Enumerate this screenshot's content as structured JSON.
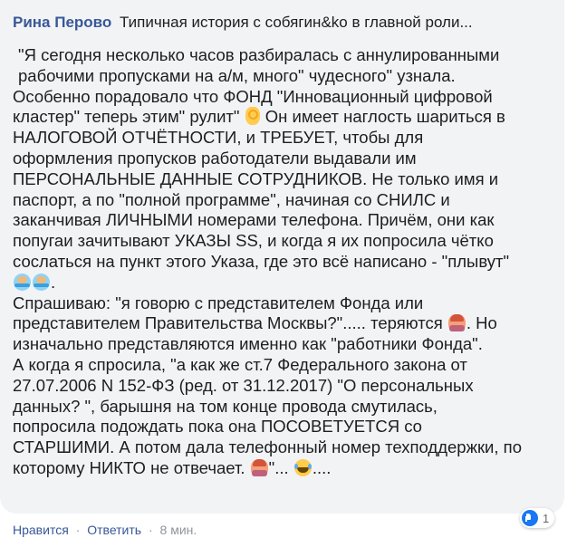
{
  "comment": {
    "author": "Рина Перово",
    "header_text": "Типичная история с собягин&ko в главной роли...",
    "body_lines": [
      {
        "text": "\"Я сегодня несколько часов разбиралась с аннулированными",
        "indent": true
      },
      {
        "text": "рабочими пропусками на а/м, много\" чудесного\" узнала.",
        "indent": true
      },
      {
        "text": "Особенно порадовало что ФОНД \"Инновационный цифровой",
        "indent": false
      },
      {
        "text": "кластер\" теперь этим\" рулит\"",
        "indent": false
      },
      {
        "text": " Он имеет наглость шариться в",
        "indent": false
      },
      {
        "text": "НАЛОГОВОЙ ОТЧЁТНОСТИ, и ТРЕБУЕТ, чтобы для",
        "indent": false
      },
      {
        "text": "оформления пропусков работодатели выдавали им",
        "indent": false
      },
      {
        "text": "ПЕРСОНАЛЬНЫЕ ДАННЫЕ СОТРУДНИКОВ. Не только имя и",
        "indent": false
      },
      {
        "text": "паспорт, а по \"полной программе\", начиная со СНИЛС и",
        "indent": false
      },
      {
        "text": "заканчивая ЛИЧНЫМИ номерами телефона. Причём, они как",
        "indent": false
      },
      {
        "text": "попугаи зачитывают УКАЗЫ SS, и когда я их попросила чётко",
        "indent": false
      },
      {
        "text": "сослаться на пункт этого Указа, где это всё написано - \"плывут\"",
        "indent": false
      },
      {
        "text": ".",
        "indent": false
      },
      {
        "text": "Спрашиваю: \"я говорю с представителем Фонда или",
        "indent": false
      },
      {
        "text": "представителем Правительства Москвы?\"..... теряются",
        "indent": false
      },
      {
        "text": ". Но",
        "indent": false
      },
      {
        "text": "изначально представляются именно как \"работники Фонда\".",
        "indent": false
      },
      {
        "text": "А когда я спросила, \"а как же ст.7 Федерального закона от",
        "indent": false
      },
      {
        "text": "27.07.2006 N 152-ФЗ (ред. от 31.12.2017) \"О персональных",
        "indent": false
      },
      {
        "text": "данных? \", барышня на том конце провода смутилась,",
        "indent": false
      },
      {
        "text": "попросила подождать пока она ПОСОВЕТУЕТСЯ со",
        "indent": false
      },
      {
        "text": "СТАРШИМИ. А потом дала телефонный номер техподдержки, по",
        "indent": false
      },
      {
        "text": "которому НИКТО не отвечает. ",
        "indent": false
      },
      {
        "text": "\"... ",
        "indent": false
      },
      {
        "text": "....",
        "indent": false
      }
    ],
    "emoji": {
      "ok": "ok-hand-emoji",
      "swim": "person-swimming-emoji",
      "facepalm": "person-facepalming-emoji",
      "laugh": "face-with-tears-of-joy-emoji"
    }
  },
  "reactions": {
    "icon": "like-icon",
    "count": "1",
    "color": "#1877f2"
  },
  "actions": {
    "like_label": "Нравится",
    "separator": "·",
    "reply_label": "Ответить",
    "timestamp": "8 мин."
  },
  "colors": {
    "bubble_bg": "#f2f3f5",
    "author": "#385898",
    "text": "#1c1e21",
    "muted": "#90949c"
  }
}
